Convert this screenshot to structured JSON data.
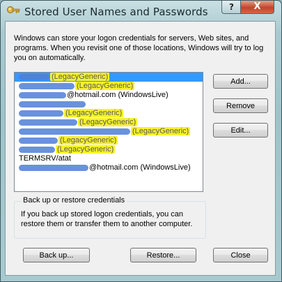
{
  "window": {
    "title": "Stored User Names and Passwords",
    "title_icon": "key-icon",
    "help_label": "?",
    "close_label": "X"
  },
  "intro_text": "Windows can store your logon credentials for servers, Web sites, and programs. When you revisit one of those locations, Windows will try to log you on automatically.",
  "credentials": [
    {
      "suffix": "(LegacyGeneric)",
      "highlighted": true,
      "selected": true
    },
    {
      "suffix": "(LegacyGeneric)",
      "highlighted": true,
      "selected": false
    },
    {
      "suffix": "@hotmail.com (WindowsLive)",
      "highlighted": false,
      "selected": false
    },
    {
      "suffix": "",
      "highlighted": false,
      "selected": false
    },
    {
      "suffix": "(LegacyGeneric)",
      "highlighted": true,
      "selected": false
    },
    {
      "suffix": "(LegacyGeneric)",
      "highlighted": true,
      "selected": false
    },
    {
      "suffix": "(LegacyGeneric)",
      "highlighted": true,
      "selected": false
    },
    {
      "suffix": "(LegacyGeneric)",
      "highlighted": true,
      "selected": false
    },
    {
      "suffix": "(LegacyGeneric)",
      "highlighted": true,
      "selected": false
    },
    {
      "suffix": "TERMSRV/atat",
      "highlighted": false,
      "selected": false
    },
    {
      "suffix": "@hotmail.com (WindowsLive)",
      "highlighted": false,
      "selected": false
    }
  ],
  "buttons": {
    "add": "Add...",
    "remove": "Remove",
    "edit": "Edit...",
    "backup": "Back up...",
    "restore": "Restore...",
    "close": "Close"
  },
  "backup_group": {
    "title": "Back up or restore credentials",
    "description": "If you back up stored logon credentials, you can restore them or transfer them to another computer."
  },
  "colors": {
    "selection": "#3399ff",
    "highlight": "#f7f22a",
    "redaction": "#4f7fd6"
  }
}
